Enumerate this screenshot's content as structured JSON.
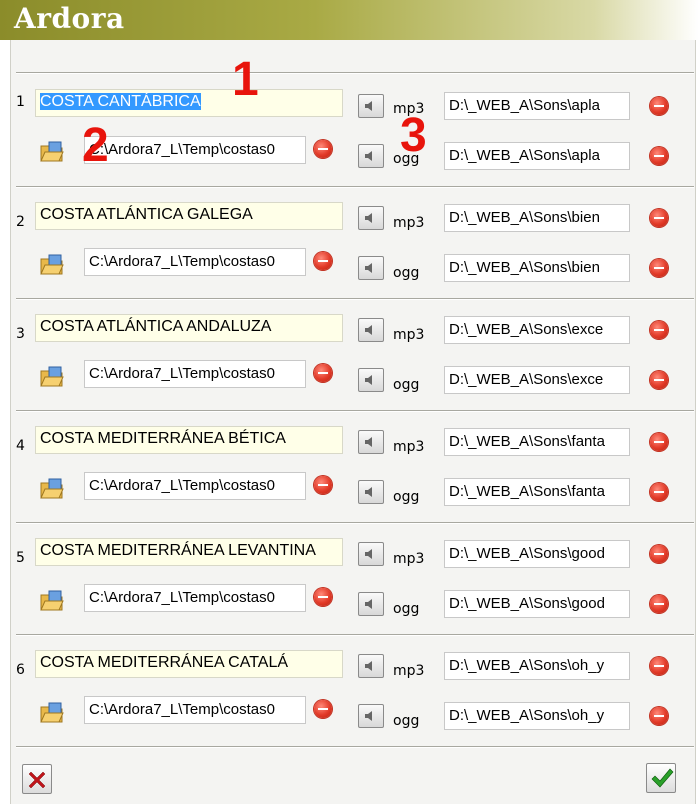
{
  "window": {
    "title": "Ardora"
  },
  "rows": [
    {
      "num": "1",
      "label": "COSTA CANTÁBRICA",
      "src": "C:\\Ardora7_L\\Temp\\costas0",
      "fmt1": "mp3",
      "fmt2": "ogg",
      "dst1": "D:\\_WEB_A\\Sons\\apla",
      "dst2": "D:\\_WEB_A\\Sons\\apla"
    },
    {
      "num": "2",
      "label": "COSTA ATLÁNTICA GALEGA",
      "src": "C:\\Ardora7_L\\Temp\\costas0",
      "fmt1": "mp3",
      "fmt2": "ogg",
      "dst1": "D:\\_WEB_A\\Sons\\bien",
      "dst2": "D:\\_WEB_A\\Sons\\bien"
    },
    {
      "num": "3",
      "label": "COSTA ATLÁNTICA ANDALUZA",
      "src": "C:\\Ardora7_L\\Temp\\costas0",
      "fmt1": "mp3",
      "fmt2": "ogg",
      "dst1": "D:\\_WEB_A\\Sons\\exce",
      "dst2": "D:\\_WEB_A\\Sons\\exce"
    },
    {
      "num": "4",
      "label": "COSTA MEDITERRÁNEA BÉTICA",
      "src": "C:\\Ardora7_L\\Temp\\costas0",
      "fmt1": "mp3",
      "fmt2": "ogg",
      "dst1": "D:\\_WEB_A\\Sons\\fanta",
      "dst2": "D:\\_WEB_A\\Sons\\fanta"
    },
    {
      "num": "5",
      "label": "COSTA MEDITERRÁNEA LEVANTINA",
      "src": "C:\\Ardora7_L\\Temp\\costas0",
      "fmt1": "mp3",
      "fmt2": "ogg",
      "dst1": "D:\\_WEB_A\\Sons\\good",
      "dst2": "D:\\_WEB_A\\Sons\\good"
    },
    {
      "num": "6",
      "label": "COSTA MEDITERRÁNEA CATALÁ",
      "src": "C:\\Ardora7_L\\Temp\\costas0",
      "fmt1": "mp3",
      "fmt2": "ogg",
      "dst1": "D:\\_WEB_A\\Sons\\oh_y",
      "dst2": "D:\\_WEB_A\\Sons\\oh_y"
    }
  ],
  "annotations": [
    "1",
    "2",
    "3"
  ],
  "icons": {
    "folder": "folder-open-icon",
    "speaker": "speaker-icon",
    "remove": "remove-icon",
    "cancel": "cancel-x-icon",
    "ok": "ok-check-icon"
  },
  "colors": {
    "title_bar": "#8b8c2a",
    "label_bg": "#ffffe8",
    "selection": "#3399ff",
    "remove": "#e23a28",
    "annotation": "#e8140c"
  }
}
